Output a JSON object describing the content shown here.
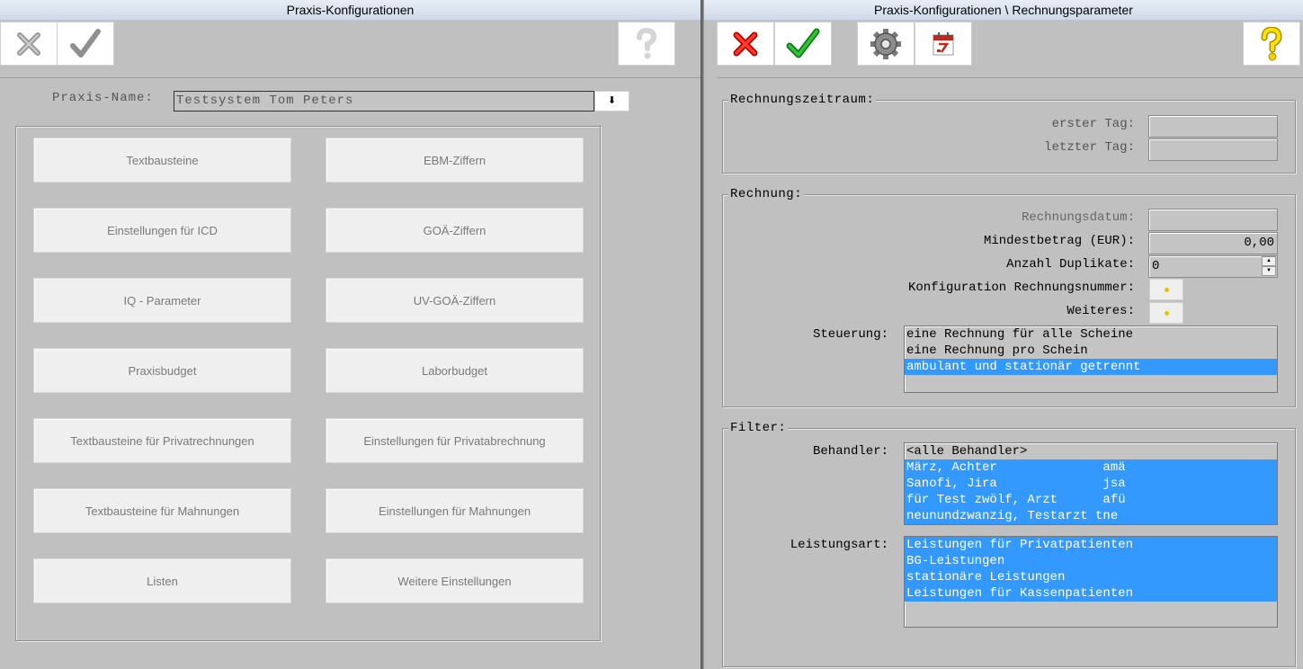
{
  "left": {
    "title": "Praxis-Konfigurationen",
    "toolbar": {
      "cancel_icon": "x-icon-disabled",
      "ok_icon": "checkmark-icon-disabled",
      "help_icon": "question-icon-disabled"
    },
    "praxis_name_label": "Praxis-Name:",
    "praxis_name_value": "Testsystem Tom Peters",
    "dropdown_glyph": "⬇",
    "buttons": [
      "Textbausteine",
      "EBM-Ziffern",
      "Einstellungen für ICD",
      "GOÄ-Ziffern",
      "IQ - Parameter",
      "UV-GOÄ-Ziffern",
      "Praxisbudget",
      "Laborbudget",
      "Textbausteine für Privatrechnungen",
      "Einstellungen für Privatabrechnung",
      "Textbausteine für Mahnungen",
      "Einstellungen für Mahnungen",
      "Listen",
      "Weitere Einstellungen"
    ]
  },
  "right": {
    "title": "Praxis-Konfigurationen \\ Rechnungsparameter",
    "toolbar": {
      "cancel_icon": "red-x-icon",
      "ok_icon": "green-check-icon",
      "settings_icon": "gear-icon",
      "calendar_icon": "calendar-icon",
      "help_icon": "yellow-question-icon"
    },
    "rechnungszeitraum": {
      "title": "Rechnungszeitraum:",
      "erster_tag_label": "erster Tag:",
      "erster_tag_value": "",
      "letzter_tag_label": "letzter Tag:",
      "letzter_tag_value": ""
    },
    "rechnung": {
      "title": "Rechnung:",
      "rechnungsdatum_label": "Rechnungsdatum:",
      "rechnungsdatum_value": "",
      "mindestbetrag_label": "Mindestbetrag (EUR):",
      "mindestbetrag_value": "0,00",
      "anzahl_duplikate_label": "Anzahl Duplikate:",
      "anzahl_duplikate_value": "0",
      "konfiguration_label": "Konfiguration Rechnungsnummer:",
      "weiteres_label": "Weiteres:",
      "steuerung_label": "Steuerung:",
      "steuerung_items": [
        "eine Rechnung für alle Scheine",
        "eine Rechnung pro Schein",
        "ambulant und stationär getrennt"
      ]
    },
    "filter": {
      "title": "Filter:",
      "behandler_label": "Behandler:",
      "behandler_items": [
        "<alle Behandler>",
        "März, Achter              amä",
        "Sanofi, Jira              jsa",
        "für Test zwölf, Arzt      afü",
        "neunundzwanzig, Testarzt tne"
      ],
      "leistungsart_label": "Leistungsart:",
      "leistungsart_items": [
        "Leistungen für Privatpatienten",
        "BG-Leistungen",
        "stationäre Leistungen",
        "Leistungen für Kassenpatienten"
      ]
    }
  }
}
